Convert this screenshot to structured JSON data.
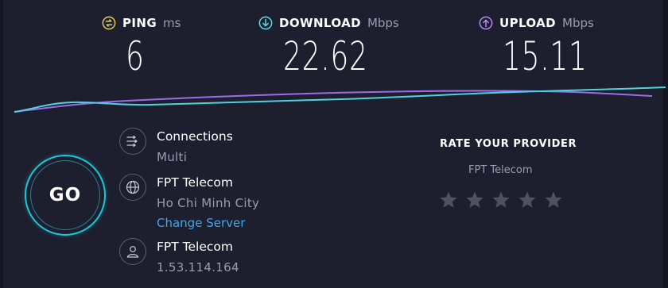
{
  "metrics": {
    "ping": {
      "label": "PING",
      "unit": "ms",
      "value": "6",
      "icon": "ping-icon",
      "color": "#e8d15f"
    },
    "download": {
      "label": "DOWNLOAD",
      "unit": "Mbps",
      "value": "22.62",
      "icon": "download-arrow-icon",
      "color": "#5ee0e8"
    },
    "upload": {
      "label": "UPLOAD",
      "unit": "Mbps",
      "value": "15.11",
      "icon": "upload-arrow-icon",
      "color": "#b98cf6"
    }
  },
  "graph": {
    "download_color": "#4fd1de",
    "upload_color": "#9a6bec"
  },
  "go_button": {
    "label": "GO",
    "color": "#1ec6d6"
  },
  "connections": {
    "title": "Connections",
    "value": "Multi",
    "icon": "connections-icon"
  },
  "server": {
    "name": "FPT Telecom",
    "location": "Ho Chi Minh City",
    "change_label": "Change Server",
    "icon": "globe-icon"
  },
  "provider": {
    "name": "FPT Telecom",
    "ip": "1.53.114.164",
    "icon": "user-icon"
  },
  "rating": {
    "title": "RATE YOUR PROVIDER",
    "provider": "FPT Telecom",
    "stars_total": 5,
    "star_color": "#4e5063"
  },
  "colors": {
    "background": "#1d1f2e",
    "link": "#3ea8e8",
    "muted_text": "#9a9cb3"
  }
}
